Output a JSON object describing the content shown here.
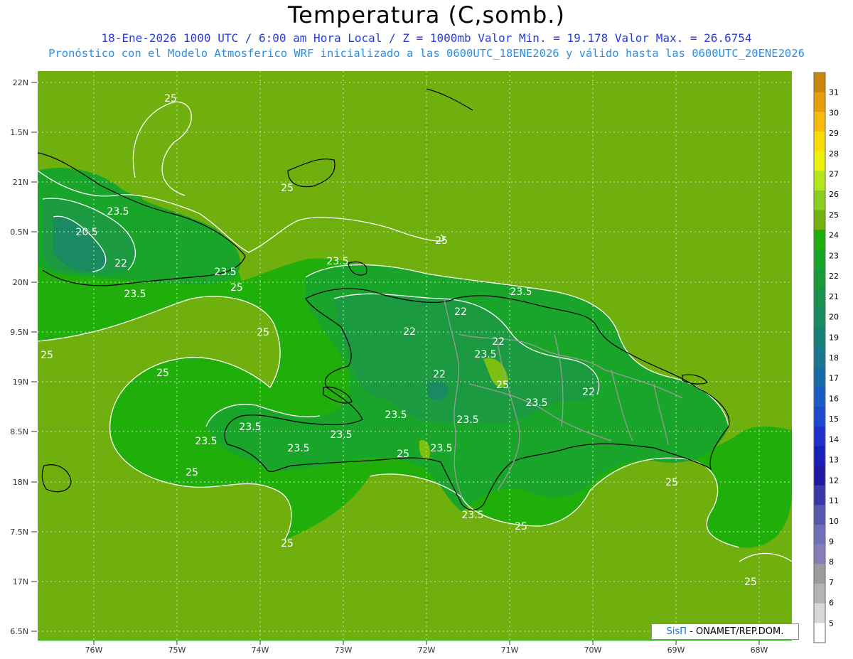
{
  "title": "Temperatura (C,somb.)",
  "subtitle_line1": "18-Ene-2026  1000 UTC / 6:00 am Hora Local / Z = 1000mb    Valor Min. = 19.178  Valor Max. = 26.6754",
  "subtitle_line2": "Pronóstico con el Modelo Atmosferico WRF inicializado a las 0600UTC_18ENE2026 y válido hasta las  0600UTC_20ENE2026",
  "credit": {
    "brand": "SisΠ",
    "text": " - ONAMET/REP.DOM."
  },
  "axes": {
    "lat_labels": [
      "22N",
      "1.5N",
      "21N",
      "0.5N",
      "20N",
      "9.5N",
      "19N",
      "8.5N",
      "18N",
      "7.5N",
      "17N",
      "6.5N"
    ],
    "lon_labels": [
      "76W",
      "75W",
      "74W",
      "73W",
      "72W",
      "71W",
      "70W",
      "69W",
      "68W"
    ]
  },
  "colorbar": {
    "labels": [
      "31",
      "30",
      "29",
      "28",
      "27",
      "26",
      "25",
      "24",
      "23",
      "22",
      "21",
      "20",
      "19",
      "18",
      "17",
      "16",
      "15",
      "14",
      "13",
      "12",
      "11",
      "10",
      "9",
      "8",
      "7",
      "6",
      "5"
    ],
    "colors": [
      "#c8860a",
      "#e59f0a",
      "#f5bc0a",
      "#f7dc0a",
      "#eef20a",
      "#b5e61e",
      "#8ccd1e",
      "#74b00e",
      "#1fae0a",
      "#19a42a",
      "#1a9a3a",
      "#1c9050",
      "#1a8a62",
      "#178078",
      "#197890",
      "#1a6aa8",
      "#1a5cc0",
      "#1f48cc",
      "#2030cc",
      "#1820b8",
      "#2018a0",
      "#3838a8",
      "#5858b0",
      "#7070b8",
      "#8a7eb8",
      "#9c9c9c",
      "#b4b4b4",
      "#d8d8d8",
      "#ffffff"
    ]
  },
  "contour_labels": [
    {
      "text": "25"
    },
    {
      "text": "25"
    },
    {
      "text": "25"
    },
    {
      "text": "25"
    },
    {
      "text": "25"
    },
    {
      "text": "25"
    },
    {
      "text": "25"
    },
    {
      "text": "25"
    },
    {
      "text": "25"
    },
    {
      "text": "25"
    },
    {
      "text": "25"
    },
    {
      "text": "25"
    },
    {
      "text": "25"
    },
    {
      "text": "25"
    },
    {
      "text": "23.5"
    },
    {
      "text": "23.5"
    },
    {
      "text": "23.5"
    },
    {
      "text": "23.5"
    },
    {
      "text": "23.5"
    },
    {
      "text": "23.5"
    },
    {
      "text": "23.5"
    },
    {
      "text": "23.5"
    },
    {
      "text": "23.5"
    },
    {
      "text": "23.5"
    },
    {
      "text": "23.5"
    },
    {
      "text": "23.5"
    },
    {
      "text": "23.5"
    },
    {
      "text": "23.5"
    },
    {
      "text": "23.5"
    },
    {
      "text": "22"
    },
    {
      "text": "22"
    },
    {
      "text": "22"
    },
    {
      "text": "22"
    },
    {
      "text": "22"
    },
    {
      "text": "22"
    },
    {
      "text": "20.5"
    }
  ]
}
